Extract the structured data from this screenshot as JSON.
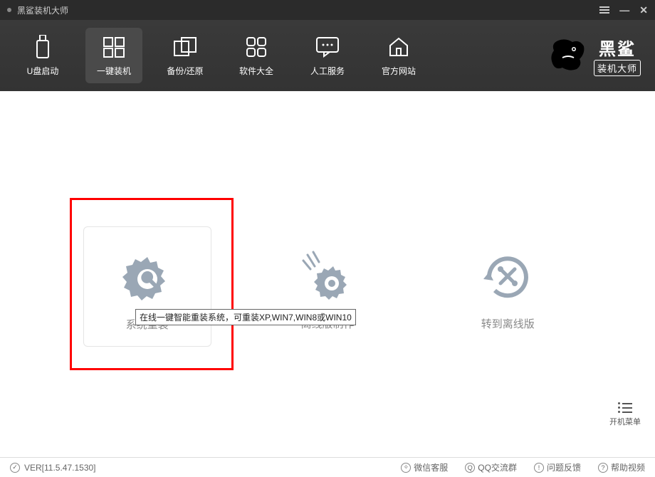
{
  "titlebar": {
    "title": "黑鲨装机大师"
  },
  "toolbar": {
    "items": [
      {
        "label": "U盘启动"
      },
      {
        "label": "一键装机"
      },
      {
        "label": "备份/还原"
      },
      {
        "label": "软件大全"
      },
      {
        "label": "人工服务"
      },
      {
        "label": "官方网站"
      }
    ]
  },
  "brand": {
    "line1": "黑鲨",
    "line2": "装机大师"
  },
  "cards": [
    {
      "label": "系统重装"
    },
    {
      "label": "离线版制作"
    },
    {
      "label": "转到离线版"
    }
  ],
  "tooltip": "在线一键智能重装系统，可重装XP,WIN7,WIN8或WIN10",
  "side_menu_label": "开机菜单",
  "statusbar": {
    "version_label": "VER[11.5.47.1530]",
    "links": [
      {
        "label": "微信客服"
      },
      {
        "label": "QQ交流群"
      },
      {
        "label": "问题反馈"
      },
      {
        "label": "帮助视频"
      }
    ]
  }
}
